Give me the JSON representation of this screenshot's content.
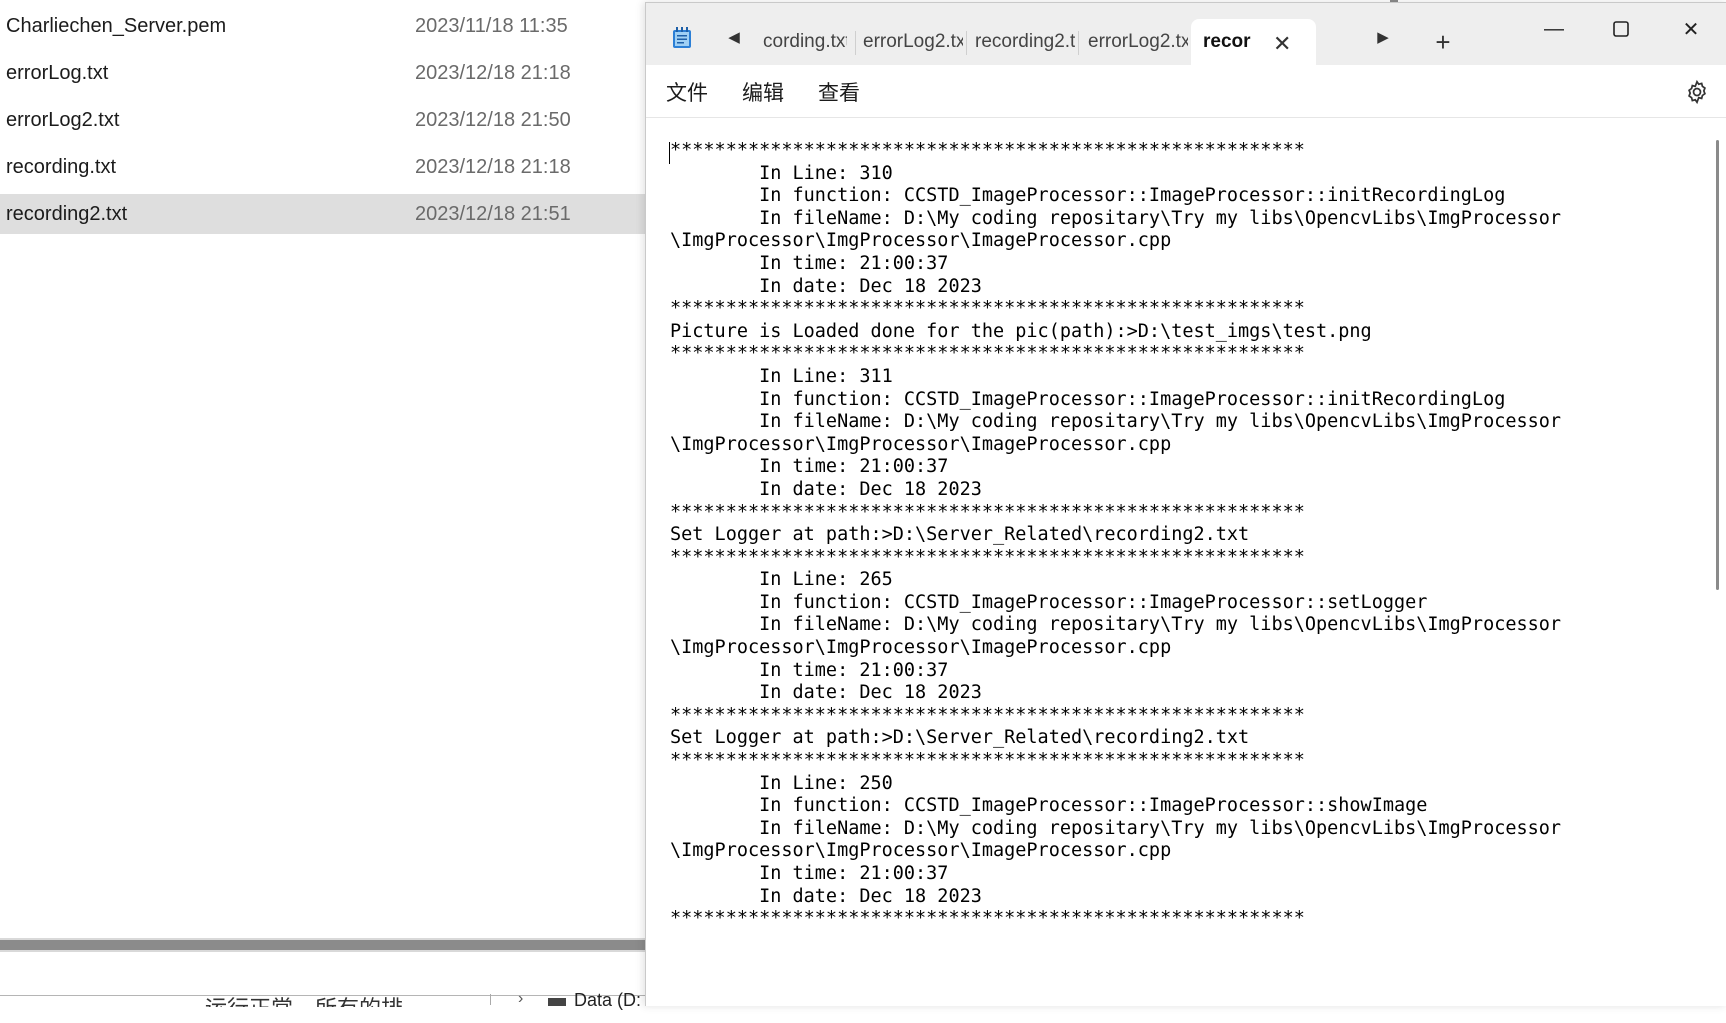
{
  "explorer": {
    "files": [
      {
        "name": "Charliechen_Server.pem",
        "date": "2023/11/18 11:35",
        "selected": false
      },
      {
        "name": "errorLog.txt",
        "date": "2023/12/18 21:18",
        "selected": false
      },
      {
        "name": "errorLog2.txt",
        "date": "2023/12/18 21:50",
        "selected": false
      },
      {
        "name": "recording.txt",
        "date": "2023/12/18 21:18",
        "selected": false
      },
      {
        "name": "recording2.txt",
        "date": "2023/12/18 21:51",
        "selected": true
      }
    ],
    "bottom_partial_text": "运行正常，所有的排",
    "bottom_folder_label": "Data (D:"
  },
  "notepad": {
    "tabs": [
      {
        "label": "cording.txt",
        "active": false
      },
      {
        "label": "errorLog2.tx",
        "active": false
      },
      {
        "label": "recording2.t",
        "active": false
      },
      {
        "label": "errorLog2.tx",
        "active": false
      },
      {
        "label": "recor",
        "active": true
      }
    ],
    "tab_close_symbol": "✕",
    "new_tab_symbol": "+",
    "window_buttons": {
      "minimize": "—",
      "maximize": "☐",
      "close": "✕"
    },
    "menu": {
      "file": "文件",
      "edit": "编辑",
      "view": "查看"
    },
    "icons": {
      "app": "notepad-icon",
      "scroll_left": "triangle-left-icon",
      "scroll_right": "triangle-right-icon",
      "settings": "gear-icon"
    },
    "content": "*********************************************************\n        In Line: 310\n        In function: CCSTD_ImageProcessor::ImageProcessor::initRecordingLog\n        In fileName: D:\\My coding repositary\\Try my libs\\OpencvLibs\\ImgProcessor\n\\ImgProcessor\\ImgProcessor\\ImageProcessor.cpp\n        In time: 21:00:37\n        In date: Dec 18 2023\n*********************************************************\nPicture is Loaded done for the pic(path):>D:\\test_imgs\\test.png\n*********************************************************\n        In Line: 311\n        In function: CCSTD_ImageProcessor::ImageProcessor::initRecordingLog\n        In fileName: D:\\My coding repositary\\Try my libs\\OpencvLibs\\ImgProcessor\n\\ImgProcessor\\ImgProcessor\\ImageProcessor.cpp\n        In time: 21:00:37\n        In date: Dec 18 2023\n*********************************************************\nSet Logger at path:>D:\\Server_Related\\recording2.txt\n*********************************************************\n        In Line: 265\n        In function: CCSTD_ImageProcessor::ImageProcessor::setLogger\n        In fileName: D:\\My coding repositary\\Try my libs\\OpencvLibs\\ImgProcessor\n\\ImgProcessor\\ImgProcessor\\ImageProcessor.cpp\n        In time: 21:00:37\n        In date: Dec 18 2023\n*********************************************************\nSet Logger at path:>D:\\Server_Related\\recording2.txt\n*********************************************************\n        In Line: 250\n        In function: CCSTD_ImageProcessor::ImageProcessor::showImage\n        In fileName: D:\\My coding repositary\\Try my libs\\OpencvLibs\\ImgProcessor\n\\ImgProcessor\\ImgProcessor\\ImageProcessor.cpp\n        In time: 21:00:37\n        In date: Dec 18 2023\n*********************************************************"
  }
}
